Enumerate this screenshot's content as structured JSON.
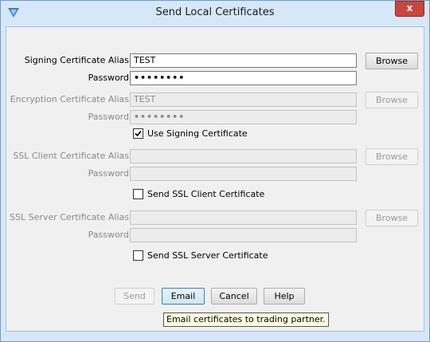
{
  "window": {
    "title": "Send Local Certificates",
    "close_label": "x"
  },
  "signing": {
    "alias_label": "Signing Certificate Alias",
    "alias_value": "TEST",
    "password_label": "Password",
    "password_value": "••••••••",
    "browse_label": "Browse"
  },
  "encryption": {
    "alias_label": "Encryption Certificate Alias",
    "alias_value": "TEST",
    "password_label": "Password",
    "password_value": "••••••••",
    "browse_label": "Browse",
    "use_signing_label": "Use Signing Certificate",
    "use_signing_checked": true
  },
  "ssl_client": {
    "alias_label": "SSL Client Certificate Alias",
    "alias_value": "",
    "password_label": "Password",
    "password_value": "",
    "browse_label": "Browse",
    "send_label": "Send SSL Client Certificate",
    "send_checked": false
  },
  "ssl_server": {
    "alias_label": "SSL Server Certificate Alias",
    "alias_value": "",
    "password_label": "Password",
    "password_value": "",
    "browse_label": "Browse",
    "send_label": "Send SSL Server Certificate",
    "send_checked": false
  },
  "buttons": {
    "send": "Send",
    "email": "Email",
    "cancel": "Cancel",
    "help": "Help"
  },
  "tooltip": {
    "text": "Email certificates to trading partner."
  },
  "colors": {
    "accent": "#3c7fb1",
    "close": "#c9463d",
    "window_frame": "#d6e8f8"
  }
}
